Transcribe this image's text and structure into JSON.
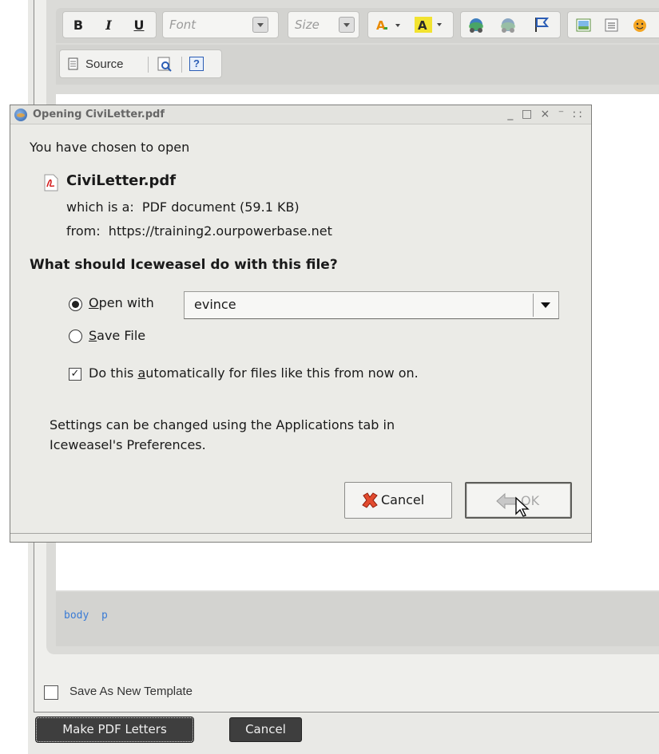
{
  "editor": {
    "toolbar": {
      "bold": "B",
      "italic": "I",
      "underline": "U",
      "font_placeholder": "Font",
      "size_placeholder": "Size",
      "source_label": "Source",
      "help_label": "?"
    },
    "path_bar": "body  p"
  },
  "form": {
    "save_template_label": "Save As New Template",
    "save_template_checked": false,
    "make_pdf_label": "Make PDF Letters",
    "cancel_label": "Cancel"
  },
  "dialog": {
    "title": "Opening CiviLetter.pdf",
    "wm_buttons": "_ □ × ⁻ ::",
    "chosen_text": "You have chosen to open",
    "filename": "CiviLetter.pdf",
    "which_is": "which is a:  PDF document (59.1 KB)",
    "from": "from:  https://training2.ourpowerbase.net",
    "question": "What should Iceweasel do with this file?",
    "open_with_label": "Open with",
    "open_with_mnemonic": "O",
    "open_with_rest": "pen with",
    "open_with_value": "evince",
    "open_with_selected": true,
    "save_file_mnemonic": "S",
    "save_file_rest": "ave File",
    "auto_pre": "Do this ",
    "auto_mnemonic": "a",
    "auto_post": "utomatically for files like this from now on.",
    "auto_checked": true,
    "settings_line1": "Settings can be changed using the Applications tab in",
    "settings_line2": "Iceweasel's Preferences.",
    "cancel_label": "Cancel",
    "ok_label": "OK"
  },
  "colors": {
    "path_text": "#3a7bd5",
    "dialog_bg": "#ebebe7",
    "page_button_bg": "#3e3e3e"
  }
}
